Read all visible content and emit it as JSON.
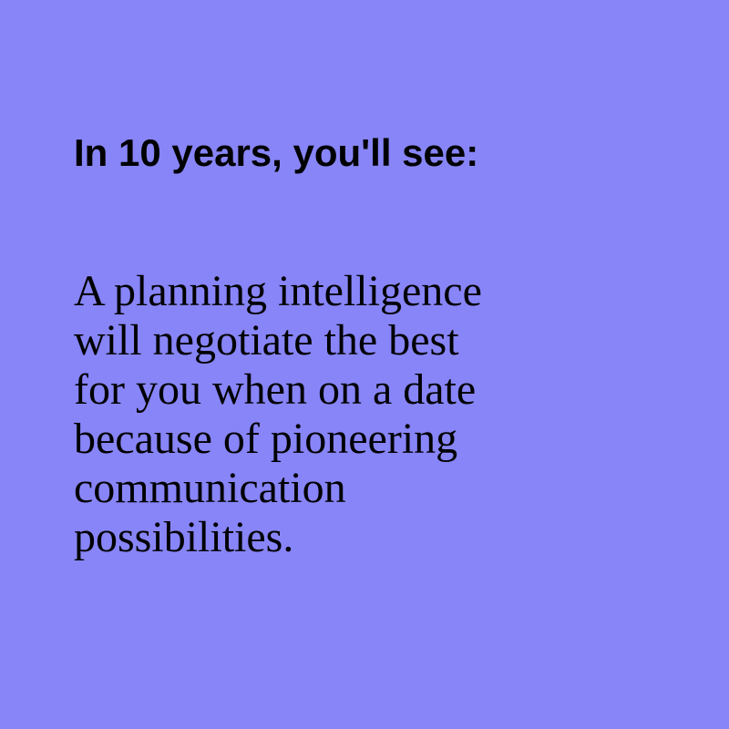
{
  "background_color": "#8785f7",
  "text_color": "#000000",
  "heading": "In 10 years, you'll see:",
  "body_lines": [
    "A planning intelligence",
    "will negotiate the best",
    "for you when on a date",
    "because of pioneering",
    "communication",
    "possibilities."
  ]
}
